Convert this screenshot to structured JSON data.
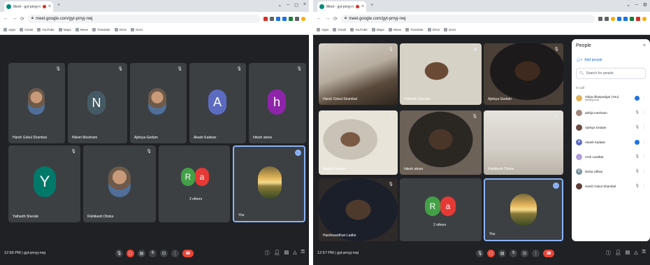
{
  "left": {
    "tab_title": "Meet - gyt-pmyj-nwj",
    "url": "meet.google.com/gyt-pmyj-nwj",
    "bookmarks": [
      "Apps",
      "Gmail",
      "YouTube",
      "Maps",
      "News",
      "Translate",
      "Drive",
      "Docs"
    ],
    "tiles": [
      {
        "name": "Harsh Gokul Shambal",
        "type": "photo"
      },
      {
        "name": "Nilesh Meshram",
        "type": "letter",
        "letter": "N",
        "color": "#455a64"
      },
      {
        "name": "Ajinkya Gedam",
        "type": "photo"
      },
      {
        "name": "Akash Kadwar",
        "type": "letter",
        "letter": "A",
        "color": "#5c6bc0"
      },
      {
        "name": "hitesh atone",
        "type": "letter",
        "letter": "h",
        "color": "#8e24aa"
      },
      {
        "name": "Yatharth Shende",
        "type": "letter",
        "letter": "Y",
        "color": "#00796b"
      },
      {
        "name": "Rishikesh Dhoke",
        "type": "photo"
      },
      {
        "name": "2 others",
        "type": "group",
        "letters": [
          "R",
          "a"
        ],
        "colors": [
          "#43a047",
          "#e53935"
        ]
      },
      {
        "name": "You",
        "type": "you"
      }
    ],
    "time": "12:56 PM | gyt-pmyj-nwj"
  },
  "right": {
    "tab_title": "Meet - gyt-pmyj-nwj",
    "url": "meet.google.com/gyt-pmyj-nwj",
    "bookmarks": [
      "Apps",
      "Gmail",
      "YouTube",
      "Maps",
      "News",
      "Translate",
      "Drive",
      "Docs"
    ],
    "tiles": [
      {
        "name": "Harsh Gokul Shambal",
        "cam": "c1"
      },
      {
        "name": "Yatharth Shende",
        "cam": "c2"
      },
      {
        "name": "Ajinkya Gedam",
        "cam": "c3"
      },
      {
        "name": "Akash Kadwar",
        "cam": "c4"
      },
      {
        "name": "hitesh atone",
        "cam": "c5"
      },
      {
        "name": "Rishikesh Dhoke",
        "cam": "c6"
      },
      {
        "name": "Harshwardhan Ladke",
        "cam": "c7"
      },
      {
        "name": "2 others",
        "group": true
      },
      {
        "name": "You",
        "you": true
      }
    ],
    "time": "12:57 PM | gyt-pmyj-nwj",
    "people": {
      "title": "People",
      "add": "Add people",
      "search_placeholder": "Search for people",
      "section": "In call",
      "list": [
        {
          "name": "Vidya dhanpadgar (You)",
          "sub": "Meeting host",
          "color": "#e2b35a",
          "letter": ""
        },
        {
          "name": "abhijit meshram",
          "color": "#a1887f",
          "letter": ""
        },
        {
          "name": "Ajinkya Gedam",
          "color": "#6d4c41",
          "letter": ""
        },
        {
          "name": "Akash Kadwar",
          "color": "#5c6bc0",
          "letter": "A"
        },
        {
          "name": "Arsh Landkar",
          "color": "#b39ddb",
          "letter": ""
        },
        {
          "name": "Disha Ullhey",
          "color": "#78909c",
          "letter": "D"
        },
        {
          "name": "Harsh Gokul Shambal",
          "color": "#5d4037",
          "letter": ""
        }
      ]
    }
  }
}
